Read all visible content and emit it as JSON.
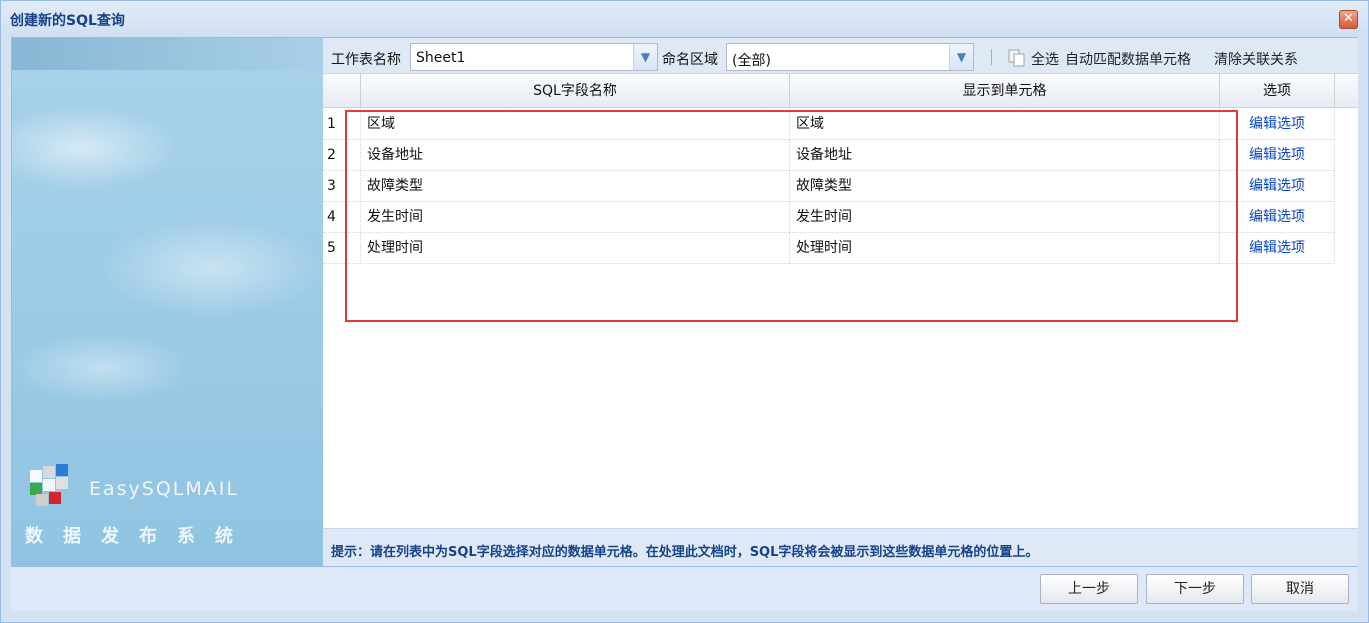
{
  "window": {
    "title": "创建新的SQL查询",
    "close_glyph": "✕"
  },
  "sidebar": {
    "brand": "EasySQLMAIL",
    "subtitle": "数据发布系统"
  },
  "toolbar": {
    "sheet_label": "工作表名称",
    "sheet_value": "Sheet1",
    "range_label": "命名区域",
    "range_value": "(全部)",
    "select_all": "全选",
    "auto_match": "自动匹配数据单元格",
    "clear_links": "清除关联关系"
  },
  "table": {
    "headers": {
      "field": "SQL字段名称",
      "cell": "显示到单元格",
      "options": "选项"
    },
    "rows": [
      {
        "num": "1",
        "field": "区域",
        "cell": "区域",
        "option": "编辑选项"
      },
      {
        "num": "2",
        "field": "设备地址",
        "cell": "设备地址",
        "option": "编辑选项"
      },
      {
        "num": "3",
        "field": "故障类型",
        "cell": "故障类型",
        "option": "编辑选项"
      },
      {
        "num": "4",
        "field": "发生时间",
        "cell": "发生时间",
        "option": "编辑选项"
      },
      {
        "num": "5",
        "field": "处理时间",
        "cell": "处理时间",
        "option": "编辑选项"
      }
    ]
  },
  "hint": "提示：请在列表中为SQL字段选择对应的数据单元格。在处理此文档时，SQL字段将会被显示到这些数据单元格的位置上。",
  "footer": {
    "prev": "上一步",
    "next": "下一步",
    "cancel": "取消"
  },
  "colors": {
    "highlight": "#e03c3c",
    "link": "#0645c3",
    "title": "#15428b"
  }
}
